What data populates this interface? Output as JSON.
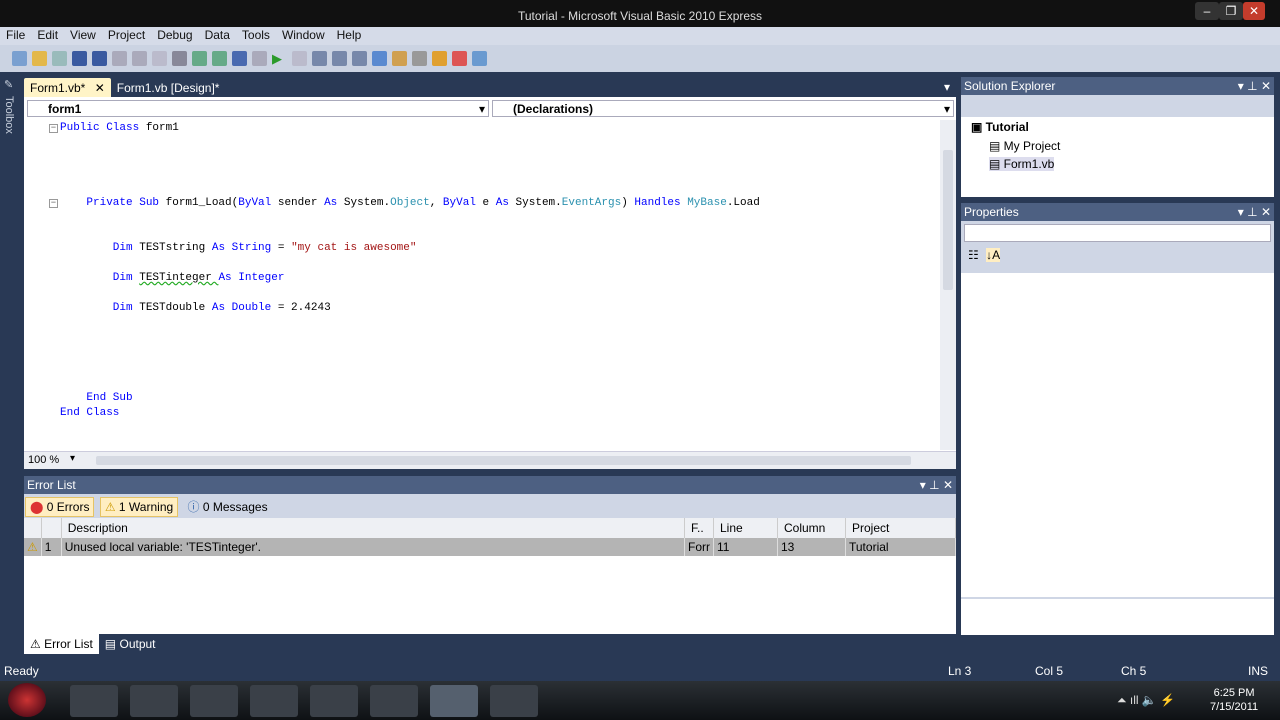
{
  "window": {
    "title": "Tutorial - Microsoft Visual Basic 2010 Express"
  },
  "menu": [
    "File",
    "Edit",
    "View",
    "Project",
    "Debug",
    "Data",
    "Tools",
    "Window",
    "Help"
  ],
  "toolbox_label": "Toolbox",
  "tabs": [
    {
      "label": "Form1.vb*",
      "close": "✕"
    },
    {
      "label": "Form1.vb [Design]*"
    }
  ],
  "editor": {
    "class_combo": "form1",
    "member_combo": "(Declarations)",
    "zoom": "100 %",
    "lines": [
      {
        "n": 1,
        "tokens": [
          [
            "kw",
            "Public Class "
          ],
          [
            "pl",
            "form1"
          ]
        ]
      },
      {
        "n": 6,
        "tokens": [
          [
            "kw",
            "    Private Sub "
          ],
          [
            "pl",
            "form1_Load("
          ],
          [
            "kw",
            "ByVal "
          ],
          [
            "pl",
            "sender "
          ],
          [
            "kw",
            "As "
          ],
          [
            "pl",
            "System."
          ],
          [
            "ty",
            "Object"
          ],
          [
            "pl",
            ", "
          ],
          [
            "kw",
            "ByVal "
          ],
          [
            "pl",
            "e "
          ],
          [
            "kw",
            "As "
          ],
          [
            "pl",
            "System."
          ],
          [
            "ty",
            "EventArgs"
          ],
          [
            "pl",
            ") "
          ],
          [
            "kw",
            "Handles "
          ],
          [
            "ty",
            "MyBase"
          ],
          [
            "pl",
            ".Load"
          ]
        ]
      },
      {
        "n": 9,
        "tokens": [
          [
            "kw",
            "        Dim "
          ],
          [
            "pl",
            "TESTstring "
          ],
          [
            "kw",
            "As String "
          ],
          [
            "pl",
            "= "
          ],
          [
            "st",
            "\"my cat is awesome\""
          ]
        ]
      },
      {
        "n": 11,
        "tokens": [
          [
            "kw",
            "        Dim "
          ],
          [
            "pl",
            "TESTinteger "
          ],
          [
            "kw",
            "As Integer"
          ]
        ]
      },
      {
        "n": 13,
        "tokens": [
          [
            "kw",
            "        Dim "
          ],
          [
            "pl",
            "TESTdouble "
          ],
          [
            "kw",
            "As Double "
          ],
          [
            "pl",
            "= 2.4243"
          ]
        ]
      },
      {
        "n": 19,
        "tokens": [
          [
            "kw",
            "    End Sub"
          ]
        ]
      },
      {
        "n": 20,
        "tokens": [
          [
            "kw",
            "End Class"
          ]
        ]
      }
    ]
  },
  "error_list": {
    "title": "Error List",
    "errors": "0 Errors",
    "warnings": "1 Warning",
    "messages": "0 Messages",
    "columns": [
      "",
      "",
      "Description",
      "F..",
      "Line",
      "Column",
      "Project"
    ],
    "rows": [
      {
        "num": "1",
        "description": "Unused local variable: 'TESTinteger'.",
        "file": "Forr",
        "line": "11",
        "column": "13",
        "project": "Tutorial"
      }
    ]
  },
  "bottom_tabs": [
    "Error List",
    "Output"
  ],
  "solution_explorer": {
    "title": "Solution Explorer",
    "root": "Tutorial",
    "items": [
      "My Project",
      "Form1.vb"
    ]
  },
  "properties": {
    "title": "Properties"
  },
  "status": {
    "text": "Ready",
    "ln": "Ln 3",
    "col": "Col 5",
    "ch": "Ch 5",
    "mode": "INS"
  },
  "taskbar": {
    "time": "6:25 PM",
    "date": "7/15/2011"
  }
}
